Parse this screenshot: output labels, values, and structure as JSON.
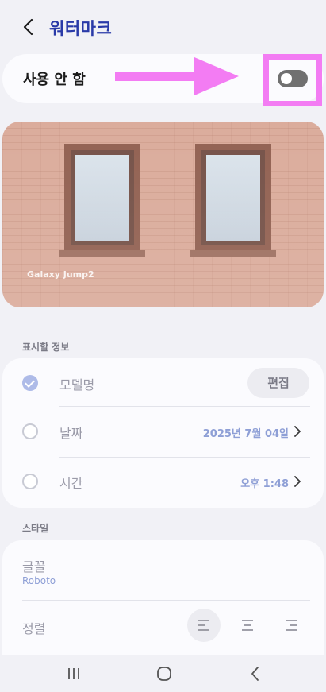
{
  "header": {
    "title": "워터마크",
    "back_icon": "chevron-left-icon"
  },
  "watermark_toggle": {
    "label": "사용 안 함",
    "state": "off"
  },
  "annotation": {
    "color": "#f37cf3"
  },
  "preview": {
    "watermark_text": "Galaxy Jump2"
  },
  "info_section": {
    "header": "표시할 정보",
    "items": [
      {
        "label": "모델명",
        "checked": true,
        "action": "편집"
      },
      {
        "label": "날짜",
        "checked": false,
        "value": "2025년 7월 04일"
      },
      {
        "label": "시간",
        "checked": false,
        "value": "오후 1:48"
      }
    ]
  },
  "style_section": {
    "header": "스타일",
    "font_label": "글꼴",
    "font_value": "Roboto",
    "align_label": "정렬",
    "align_options": [
      "align-left-icon",
      "align-center-icon",
      "align-right-icon"
    ],
    "align_selected": "align-left-icon"
  },
  "navbar": {
    "buttons": [
      "recent-apps-icon",
      "home-icon",
      "back-icon"
    ]
  }
}
